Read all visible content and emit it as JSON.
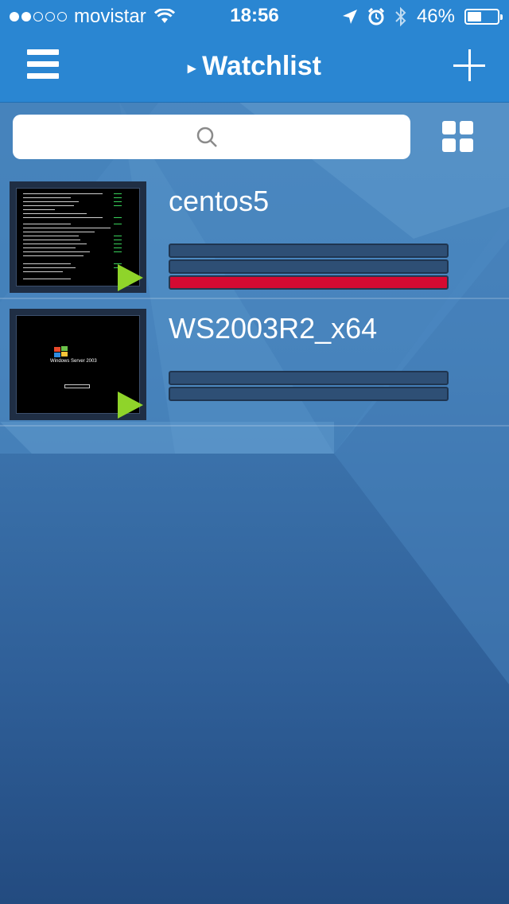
{
  "status_bar": {
    "signal_dots_filled": 2,
    "signal_dots_total": 5,
    "carrier": "movistar",
    "time": "18:56",
    "battery_percent": "46%",
    "battery_level": 0.46,
    "icons": [
      "wifi-icon",
      "location-arrow-icon",
      "alarm-icon",
      "bluetooth-icon",
      "battery-icon"
    ]
  },
  "navbar": {
    "title_marker": "▸",
    "title": "Watchlist",
    "left_icon": "hamburger-menu-icon",
    "right_icon": "plus-icon"
  },
  "search": {
    "placeholder": "",
    "icon": "magnifier-icon"
  },
  "view_toggle_icon": "grid-icon",
  "vms": [
    {
      "name": "centos5",
      "thumbnail": "linux-console-screenshot",
      "play_icon": "play-icon",
      "bars": [
        {
          "state": "normal"
        },
        {
          "state": "normal"
        },
        {
          "state": "alert"
        }
      ]
    },
    {
      "name": "WS2003R2_x64",
      "thumbnail": "windows-server-boot-screenshot",
      "thumbnail_text": "Windows Server 2003",
      "play_icon": "play-icon",
      "bars": [
        {
          "state": "normal"
        },
        {
          "state": "normal"
        }
      ]
    }
  ],
  "colors": {
    "accent": "#2a86d2",
    "bar_normal": "#2e4f75",
    "bar_alert": "#d50a32",
    "play": "#8fd42a"
  }
}
